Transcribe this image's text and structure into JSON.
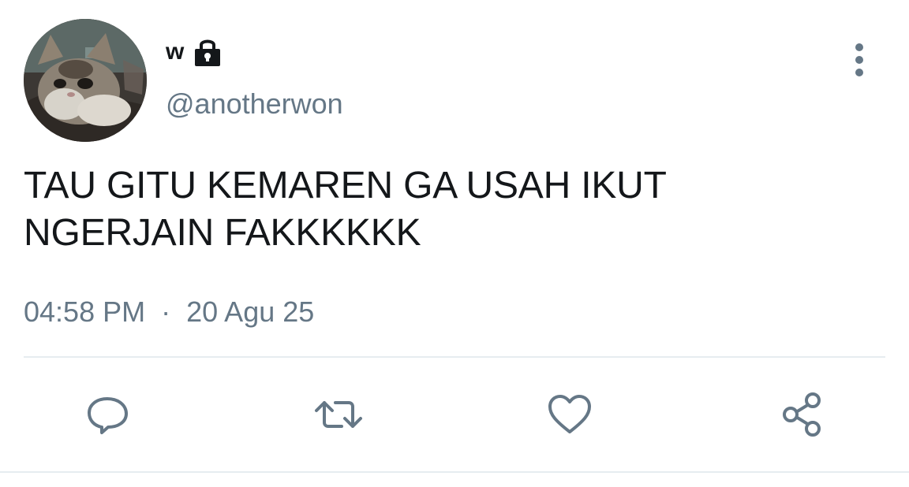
{
  "tweet": {
    "author": {
      "display_name": "w",
      "handle": "@anotherwon",
      "avatar_alt": "cat-avatar",
      "protected_icon": "lock-icon"
    },
    "more_icon": "more-vertical-icon",
    "text": "TAU GITU KEMAREN GA USAH IKUT\nNGERJAIN FAKKKKKK",
    "time": "04:58 PM",
    "separator": "·",
    "date": "20 Agu 25"
  },
  "actions": {
    "reply_icon": "reply-icon",
    "retweet_icon": "retweet-icon",
    "like_icon": "like-icon",
    "share_icon": "share-icon"
  },
  "colors": {
    "text": "#14171a",
    "secondary": "#657786",
    "divider": "#e6ecf0"
  }
}
